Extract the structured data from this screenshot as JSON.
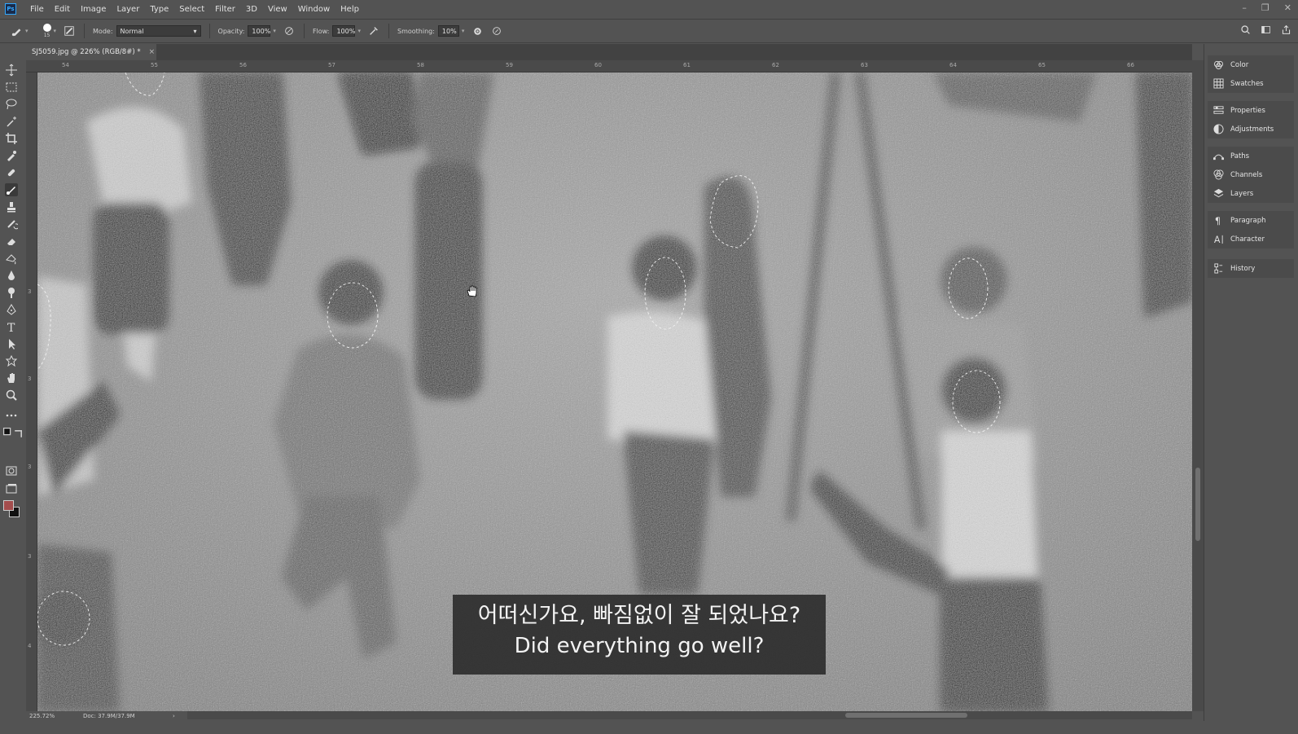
{
  "app": {
    "logo": "Ps",
    "menu": [
      "File",
      "Edit",
      "Image",
      "Layer",
      "Type",
      "Select",
      "Filter",
      "3D",
      "View",
      "Window",
      "Help"
    ],
    "window_controls": [
      "–",
      "❐",
      "✕"
    ]
  },
  "options": {
    "brush_size": "15",
    "mode_label": "Mode:",
    "mode_value": "Normal",
    "opacity_label": "Opacity:",
    "opacity_value": "100%",
    "flow_label": "Flow:",
    "flow_value": "100%",
    "smoothing_label": "Smoothing:",
    "smoothing_value": "10%"
  },
  "document": {
    "tab_title": "SJ5059.jpg @ 226% (RGB/8#) *",
    "tab_close": "×"
  },
  "rulers": {
    "top": [
      "54",
      "55",
      "56",
      "57",
      "58",
      "59",
      "60",
      "61",
      "62",
      "63",
      "64",
      "65",
      "66"
    ],
    "left": [
      "3",
      "3",
      "3",
      "3",
      "4"
    ]
  },
  "status": {
    "zoom": "225.72%",
    "doc": "Doc: 37.9M/37.9M",
    "arrow": "›"
  },
  "panels": [
    {
      "group": [
        "Color",
        "Swatches"
      ]
    },
    {
      "group": [
        "Properties",
        "Adjustments"
      ]
    },
    {
      "group": [
        "Paths",
        "Channels",
        "Layers"
      ]
    },
    {
      "group": [
        "Paragraph",
        "Character"
      ]
    },
    {
      "group": [
        "History"
      ]
    }
  ],
  "subtitle": {
    "line1": "어떠신가요, 빠짐없이 잘 되었나요?",
    "line2": "Did everything go well?"
  },
  "colors": {
    "foreground": "#a34d4d",
    "background": "#111111",
    "accent": "#31a8ff"
  }
}
